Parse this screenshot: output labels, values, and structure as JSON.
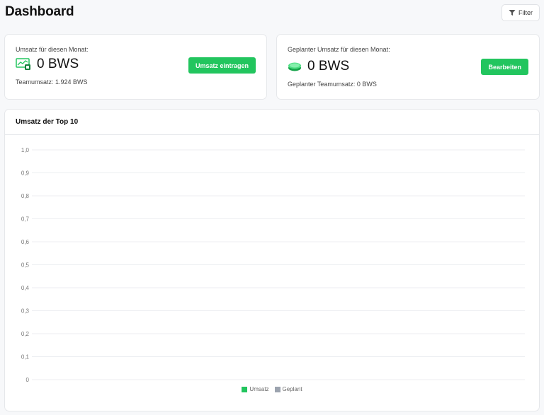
{
  "header": {
    "title": "Dashboard",
    "filter_label": "Filter"
  },
  "revenue_card": {
    "label": "Umsatz für diesen Monat:",
    "value": "0 BWS",
    "sub": "Teamumsatz: 1.924 BWS",
    "button": "Umsatz eintragen",
    "icon": "chart-monitor-icon"
  },
  "planned_card": {
    "label": "Geplanter Umsatz für diesen Monat:",
    "value": "0 BWS",
    "sub": "Geplanter Teamumsatz: 0 BWS",
    "button": "Bearbeiten",
    "icon": "coin-stack-icon"
  },
  "chart_card": {
    "title": "Umsatz der Top 10"
  },
  "chart_data": {
    "type": "bar",
    "title": "Umsatz der Top 10",
    "categories": [],
    "series": [
      {
        "name": "Umsatz",
        "color": "#22c55e",
        "values": []
      },
      {
        "name": "Geplant",
        "color": "#9ca3af",
        "values": []
      }
    ],
    "y_ticks": [
      "0",
      "0,1",
      "0,2",
      "0,3",
      "0,4",
      "0,5",
      "0,6",
      "0,7",
      "0,8",
      "0,9",
      "1,0"
    ],
    "ylim": [
      0,
      1
    ],
    "grid": true,
    "legend": "bottom-center"
  },
  "colors": {
    "accent": "#22c55e",
    "planned": "#9ca3af"
  }
}
